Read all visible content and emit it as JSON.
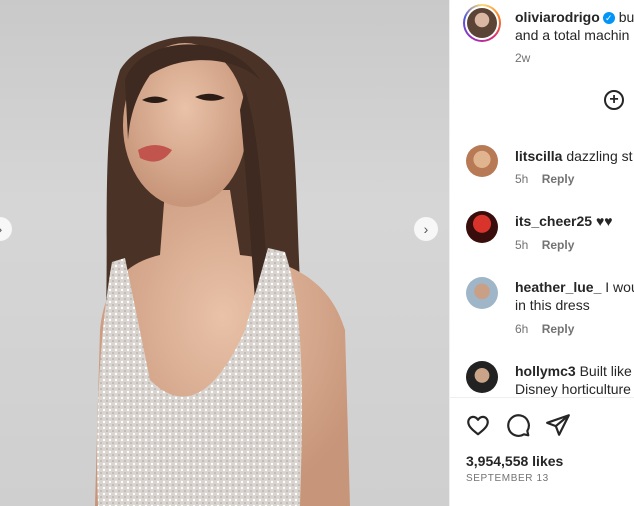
{
  "post": {
    "author": "oliviarodrigo",
    "caption_line1": "bu",
    "caption_line2": "and a total machin",
    "age": "2w"
  },
  "comments": [
    {
      "user": "litscilla",
      "text": "dazzling st",
      "text2": "",
      "time": "5h",
      "reply": "Reply",
      "avatar_color": "#b77a55"
    },
    {
      "user": "its_cheer25",
      "text": "♥♥",
      "text2": "",
      "time": "5h",
      "reply": "Reply",
      "avatar_color": "#8a1b1b"
    },
    {
      "user": "heather_lue_",
      "text": "I wou",
      "text2": "in this dress",
      "time": "6h",
      "reply": "Reply",
      "avatar_color": "#9fb6c8"
    },
    {
      "user": "hollymc3",
      "text": "Built like",
      "text2": "Disney horticulture",
      "avatar_color": "#222222"
    }
  ],
  "stats": {
    "likes": "3,954,558 likes",
    "date": "SEPTEMBER 13"
  },
  "icons": [
    "heart-icon",
    "comment-icon",
    "share-icon",
    "add-icon",
    "verified-icon",
    "chevron-right-icon",
    "chevron-left-icon"
  ]
}
